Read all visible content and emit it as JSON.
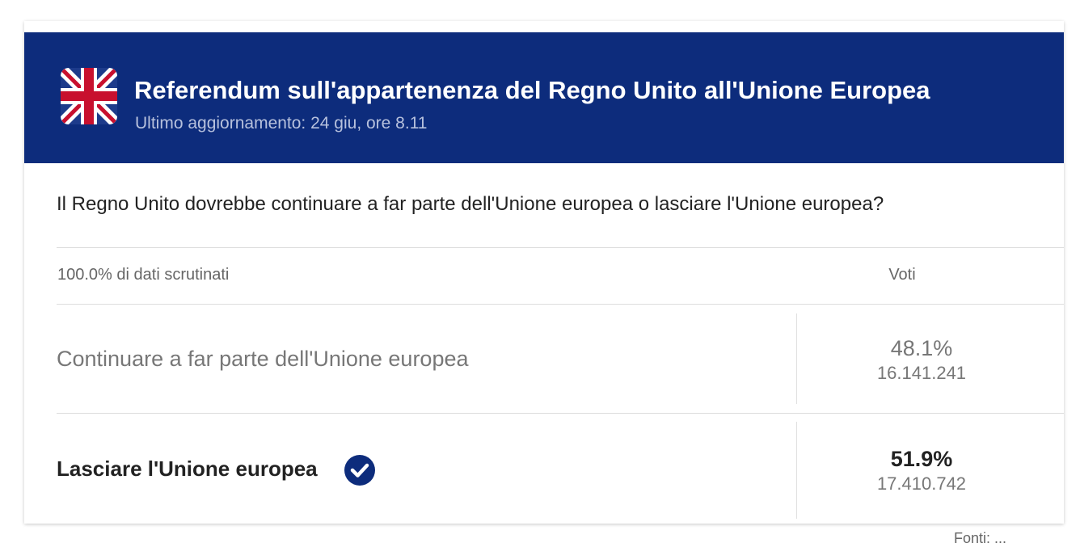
{
  "header": {
    "title": "Referendum sull'appartenenza del Regno Unito all'Unione Europea",
    "subtitle": "Ultimo aggiornamento: 24 giu, ore 8.11",
    "flag_icon": "uk-flag-icon",
    "background_color": "#0d2c7c"
  },
  "question": "Il Regno Unito dovrebbe continuare a far parte dell'Unione europea o lasciare l'Unione europea?",
  "table": {
    "counted_label": "100.0% di dati scrutinati",
    "votes_header": "Voti",
    "options": [
      {
        "label": "Continuare a far parte dell'Unione europea",
        "percent": "48.1%",
        "votes": "16.141.241",
        "winner": false
      },
      {
        "label": "Lasciare l'Unione europea",
        "percent": "51.9%",
        "votes": "17.410.742",
        "winner": true,
        "winner_icon": "check-circle-icon"
      }
    ]
  },
  "footer": {
    "source_partial": "Fonti: ..."
  }
}
